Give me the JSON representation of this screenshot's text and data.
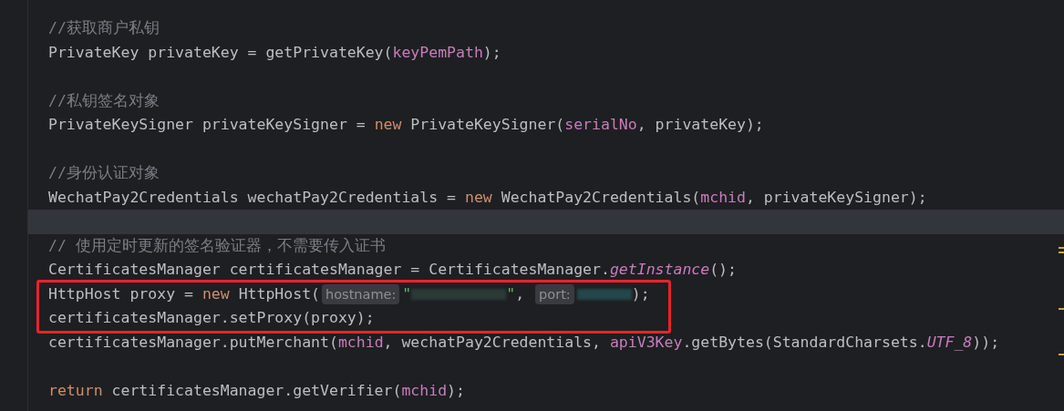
{
  "editor": {
    "lines": [
      {
        "current": false,
        "boxed": false,
        "tokens": [
          {
            "kind": "comment",
            "text": "//获取商户私钥"
          }
        ]
      },
      {
        "current": false,
        "boxed": false,
        "tokens": [
          {
            "kind": "plain",
            "text": "PrivateKey privateKey = getPrivateKey("
          },
          {
            "kind": "field",
            "text": "keyPemPath"
          },
          {
            "kind": "plain",
            "text": ");"
          }
        ]
      },
      {
        "current": false,
        "boxed": false
      },
      {
        "current": false,
        "boxed": false,
        "tokens": [
          {
            "kind": "comment",
            "text": "//私钥签名对象"
          }
        ]
      },
      {
        "current": false,
        "boxed": false,
        "tokens": [
          {
            "kind": "plain",
            "text": "PrivateKeySigner privateKeySigner = "
          },
          {
            "kind": "keyword",
            "text": "new"
          },
          {
            "kind": "plain",
            "text": " PrivateKeySigner("
          },
          {
            "kind": "field",
            "text": "serialNo"
          },
          {
            "kind": "plain",
            "text": ", privateKey);"
          }
        ]
      },
      {
        "current": false,
        "boxed": false
      },
      {
        "current": false,
        "boxed": false,
        "tokens": [
          {
            "kind": "comment",
            "text": "//身份认证对象"
          }
        ]
      },
      {
        "current": false,
        "boxed": false,
        "tokens": [
          {
            "kind": "plain",
            "text": "WechatPay2Credentials wechatPay2Credentials = "
          },
          {
            "kind": "keyword",
            "text": "new"
          },
          {
            "kind": "plain",
            "text": " WechatPay2Credentials("
          },
          {
            "kind": "field",
            "text": "mchid"
          },
          {
            "kind": "plain",
            "text": ", privateKeySigner);"
          }
        ]
      },
      {
        "current": true,
        "boxed": false
      },
      {
        "current": false,
        "boxed": false,
        "tokens": [
          {
            "kind": "comment",
            "text": "// 使用定时更新的签名验证器，不需要传入证书"
          }
        ]
      },
      {
        "current": false,
        "boxed": false,
        "tokens": [
          {
            "kind": "plain",
            "text": "CertificatesManager certificatesManager = CertificatesManager."
          },
          {
            "kind": "static",
            "text": "getInstance"
          },
          {
            "kind": "plain",
            "text": "();"
          }
        ]
      },
      {
        "current": false,
        "boxed": true,
        "tokens": [
          {
            "kind": "plain",
            "text": "HttpHost proxy = "
          },
          {
            "kind": "keyword",
            "text": "new"
          },
          {
            "kind": "plain",
            "text": " HttpHost("
          },
          {
            "kind": "hint",
            "text": "hostname:"
          },
          {
            "kind": "string",
            "text": "\""
          },
          {
            "kind": "redacted"
          },
          {
            "kind": "string",
            "text": "\""
          },
          {
            "kind": "plain",
            "text": ", "
          },
          {
            "kind": "hint",
            "text": "port:"
          },
          {
            "kind": "redacted"
          },
          {
            "kind": "plain",
            "text": ");"
          }
        ]
      },
      {
        "current": false,
        "boxed": true,
        "tokens": [
          {
            "kind": "plain",
            "text": "certificatesManager.setProxy(proxy);"
          }
        ]
      },
      {
        "current": false,
        "boxed": false,
        "tokens": [
          {
            "kind": "plain",
            "text": "certificatesManager.putMerchant("
          },
          {
            "kind": "field",
            "text": "mchid"
          },
          {
            "kind": "plain",
            "text": ", wechatPay2Credentials, "
          },
          {
            "kind": "field",
            "text": "apiV3Key"
          },
          {
            "kind": "plain",
            "text": ".getBytes(StandardCharsets."
          },
          {
            "kind": "static",
            "text": "UTF_8"
          },
          {
            "kind": "plain",
            "text": "));"
          }
        ]
      },
      {
        "current": false,
        "boxed": false
      },
      {
        "current": false,
        "boxed": false,
        "tokens": [
          {
            "kind": "keyword",
            "text": "return"
          },
          {
            "kind": "plain",
            "text": " certificatesManager.getVerifier("
          },
          {
            "kind": "field",
            "text": "mchid"
          },
          {
            "kind": "plain",
            "text": ");"
          }
        ]
      }
    ]
  }
}
